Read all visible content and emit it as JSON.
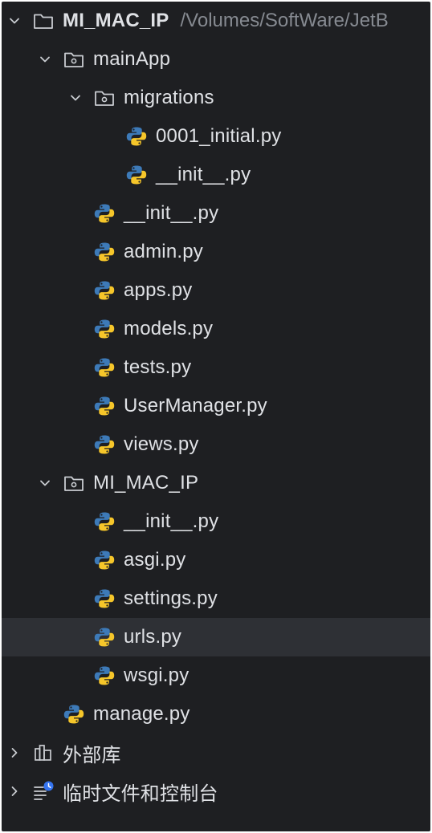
{
  "tree": {
    "root": {
      "label": "MI_MAC_IP",
      "path": "/Volumes/SoftWare/JetB"
    },
    "mainApp": {
      "label": "mainApp"
    },
    "migrations": {
      "label": "migrations"
    },
    "migration_files": [
      "0001_initial.py",
      "__init__.py"
    ],
    "mainApp_files": [
      "__init__.py",
      "admin.py",
      "apps.py",
      "models.py",
      "tests.py",
      "UserManager.py",
      "views.py"
    ],
    "pkg": {
      "label": "MI_MAC_IP"
    },
    "pkg_files": [
      "__init__.py",
      "asgi.py",
      "settings.py",
      "urls.py",
      "wsgi.py"
    ],
    "manage": "manage.py",
    "external_libraries": "外部库",
    "scratches": "临时文件和控制台"
  },
  "selected_file": "urls.py",
  "icons": {
    "chevron_expanded": "chevron-down-icon",
    "chevron_collapsed": "chevron-right-icon",
    "folder": "folder-icon",
    "package": "package-folder-icon",
    "python": "python-file-icon",
    "libraries": "external-libraries-icon",
    "scratches": "scratches-consoles-icon"
  },
  "colors": {
    "background": "#1e1f22",
    "selection": "#2e3035",
    "text": "#dfe1e5",
    "path_text": "#868a91",
    "python_blue": "#3d7ab8",
    "python_yellow": "#f6c62a",
    "badge_blue": "#3574f0"
  }
}
